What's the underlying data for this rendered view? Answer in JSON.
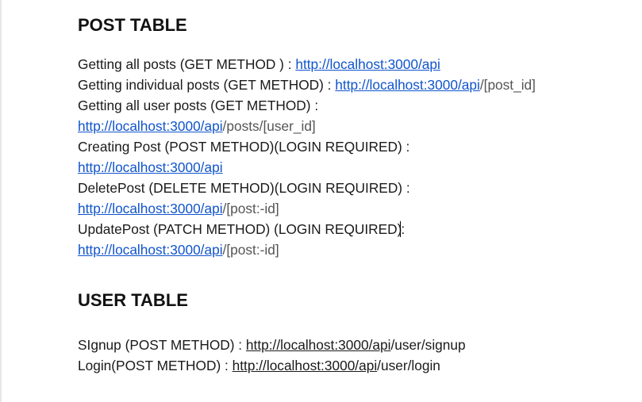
{
  "post_table": {
    "title": "POST TABLE",
    "entries": [
      {
        "text": "Getting all posts (GET METHOD ) : ",
        "url": "http://localhost:3000/api",
        "suffix": ""
      },
      {
        "text": "Getting individual posts (GET METHOD) : ",
        "url": "http://localhost:3000/api",
        "suffix": "/[post_id]"
      },
      {
        "text": "Getting all user posts (GET METHOD) :",
        "url": "http://localhost:3000/api",
        "suffix": "/posts/[user_id]"
      },
      {
        "text": "Creating Post (POST METHOD)(LOGIN REQUIRED) :",
        "url": "http://localhost:3000/api",
        "suffix": ""
      },
      {
        "text": "DeletePost (DELETE METHOD)(LOGIN REQUIRED) :",
        "url": "http://localhost:3000/api",
        "suffix": "/[post:-id]"
      },
      {
        "text": "UpdatePost (PATCH METHOD) (LOGIN REQUIRED)",
        "url": "http://localhost:3000/api",
        "suffix": "/[post:-id]"
      }
    ]
  },
  "user_table": {
    "title": "USER TABLE",
    "entries": [
      {
        "text": "SIgnup (POST METHOD) : ",
        "url": "http://localhost:3000/api",
        "suffix": "/user/signup"
      },
      {
        "text": "Login(POST METHOD) : ",
        "url": "http://localhost:3000/api",
        "suffix": "/user/login"
      }
    ]
  }
}
